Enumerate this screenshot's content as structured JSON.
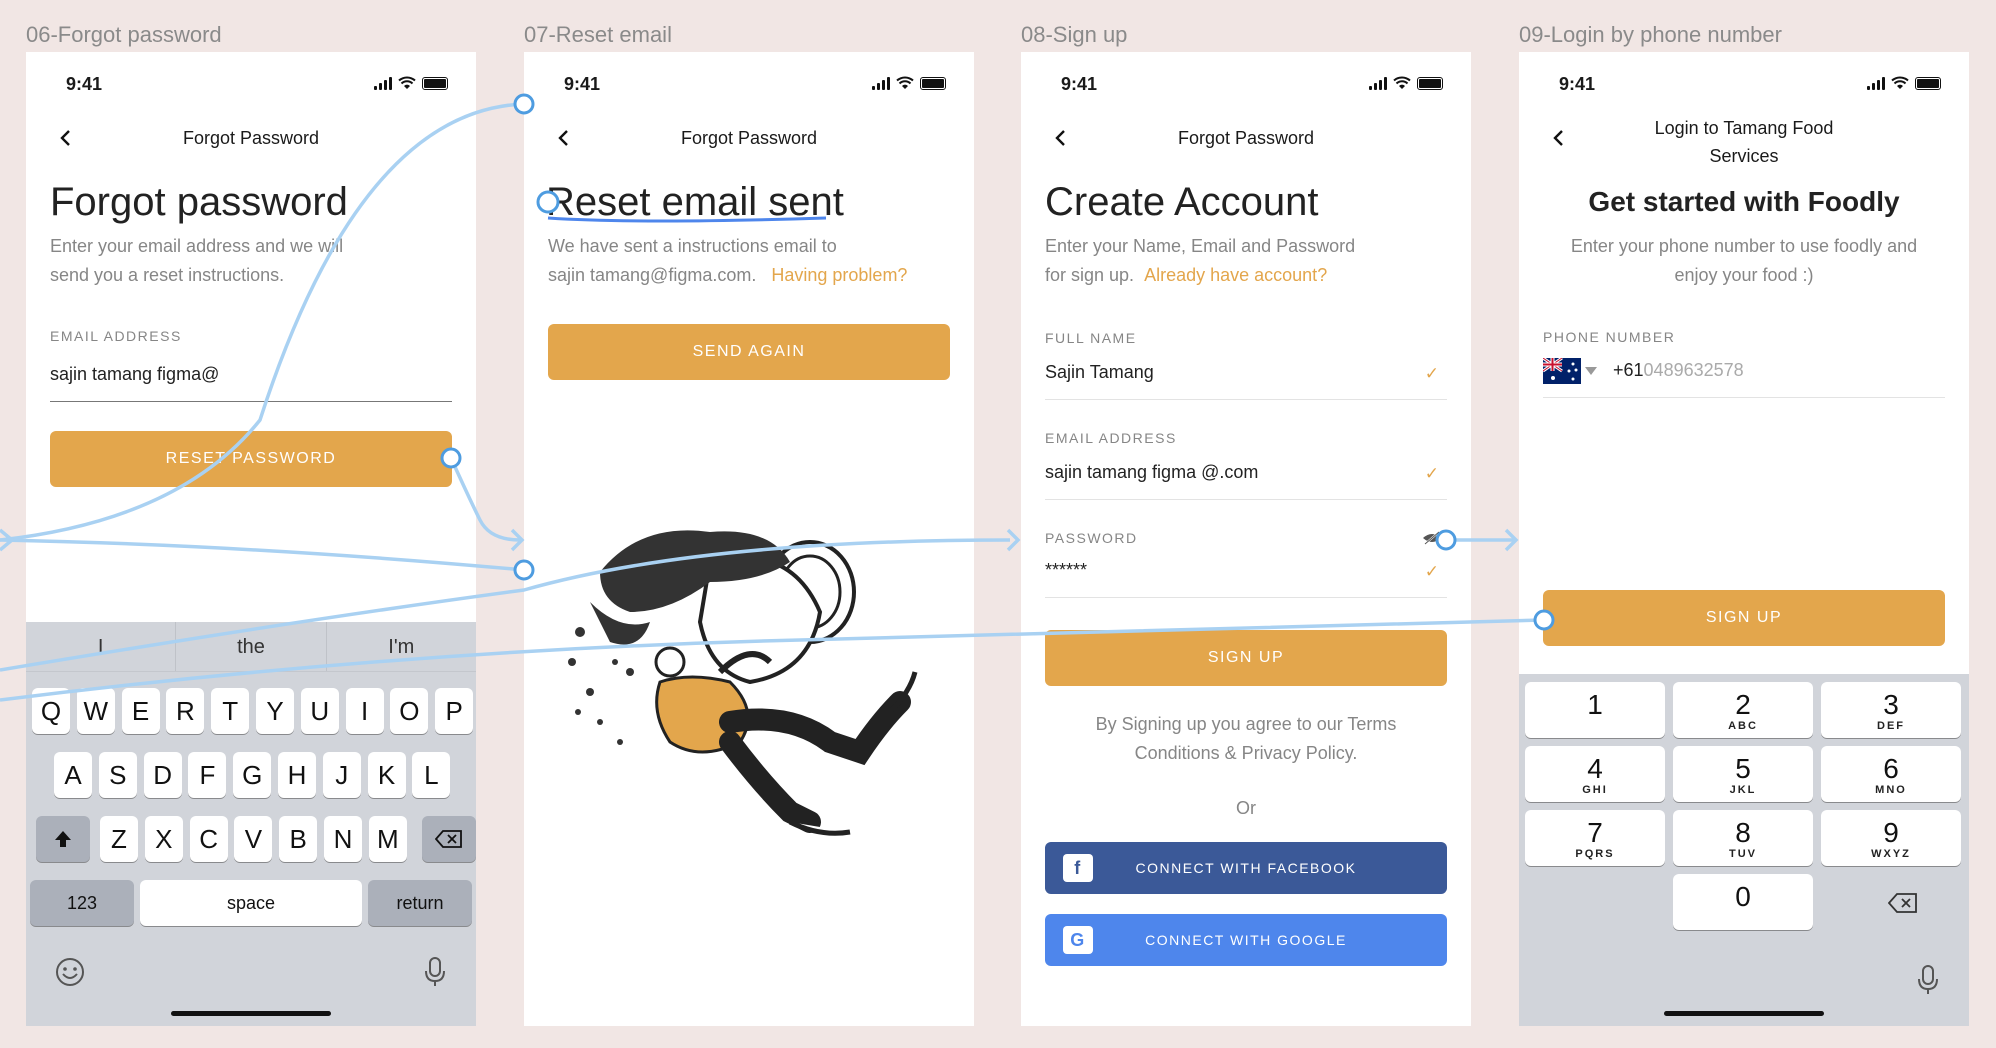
{
  "frames": [
    {
      "title": "06-Forgot password"
    },
    {
      "title": "07-Reset email"
    },
    {
      "title": "08-Sign up"
    },
    {
      "title": "09-Login by phone number"
    }
  ],
  "status": {
    "time": "9:41"
  },
  "s1": {
    "nav_title": "Forgot Password",
    "heading": "Forgot password",
    "desc_line1": "Enter your email address and we will",
    "desc_line2": "send you a reset instructions.",
    "email_label": "EMAIL ADDRESS",
    "email_value": "sajin tamang figma@",
    "button": "RESET PASSWORD",
    "suggestions": [
      "I",
      "the",
      "I'm"
    ],
    "row1": [
      "Q",
      "W",
      "E",
      "R",
      "T",
      "Y",
      "U",
      "I",
      "O",
      "P"
    ],
    "row2": [
      "A",
      "S",
      "D",
      "F",
      "G",
      "H",
      "J",
      "K",
      "L"
    ],
    "row3": [
      "Z",
      "X",
      "C",
      "V",
      "B",
      "N",
      "M"
    ],
    "key_123": "123",
    "key_space": "space",
    "key_return": "return"
  },
  "s2": {
    "nav_title": "Forgot Password",
    "heading": "Reset email sent",
    "desc_line1": "We have sent a instructions email to",
    "desc_line2": "sajin tamang@figma.com.",
    "problem_link": "Having problem?",
    "button": "SEND AGAIN"
  },
  "s3": {
    "nav_title": "Forgot Password",
    "heading": "Create Account",
    "desc_line1": "Enter your Name, Email and Password",
    "desc_line2": "for sign up.",
    "account_link": "Already have account?",
    "name_label": "FULL NAME",
    "name_value": "Sajin Tamang",
    "email_label": "EMAIL ADDRESS",
    "email_value": "sajin tamang figma @.com",
    "password_label": "PASSWORD",
    "password_value": "******",
    "button": "SIGN UP",
    "terms_line1": "By Signing up you agree to our Terms",
    "terms_line2": "Conditions & Privacy Policy.",
    "or": "Or",
    "facebook": "CONNECT WITH FACEBOOK",
    "google": "CONNECT WITH GOOGLE"
  },
  "s4": {
    "nav_title_1": "Login to Tamang Food",
    "nav_title_2": "Services",
    "heading": "Get started with Foodly",
    "desc_line1": "Enter your phone number to use foodly and",
    "desc_line2": "enjoy your food :)",
    "phone_label": "PHONE NUMBER",
    "country_code": "+61",
    "phone_placeholder": "0489632578",
    "button": "SIGN UP",
    "numpad": [
      {
        "n": "1",
        "l": ""
      },
      {
        "n": "2",
        "l": "ABC"
      },
      {
        "n": "3",
        "l": "DEF"
      },
      {
        "n": "4",
        "l": "GHI"
      },
      {
        "n": "5",
        "l": "JKL"
      },
      {
        "n": "6",
        "l": "MNO"
      },
      {
        "n": "7",
        "l": "PQRS"
      },
      {
        "n": "8",
        "l": "TUV"
      },
      {
        "n": "9",
        "l": "WXYZ"
      },
      {
        "n": "0",
        "l": ""
      }
    ]
  },
  "colors": {
    "accent": "#E3A64C",
    "facebook": "#3B5998",
    "google": "#4E86EC",
    "flow_line": "#A9D1F2"
  }
}
